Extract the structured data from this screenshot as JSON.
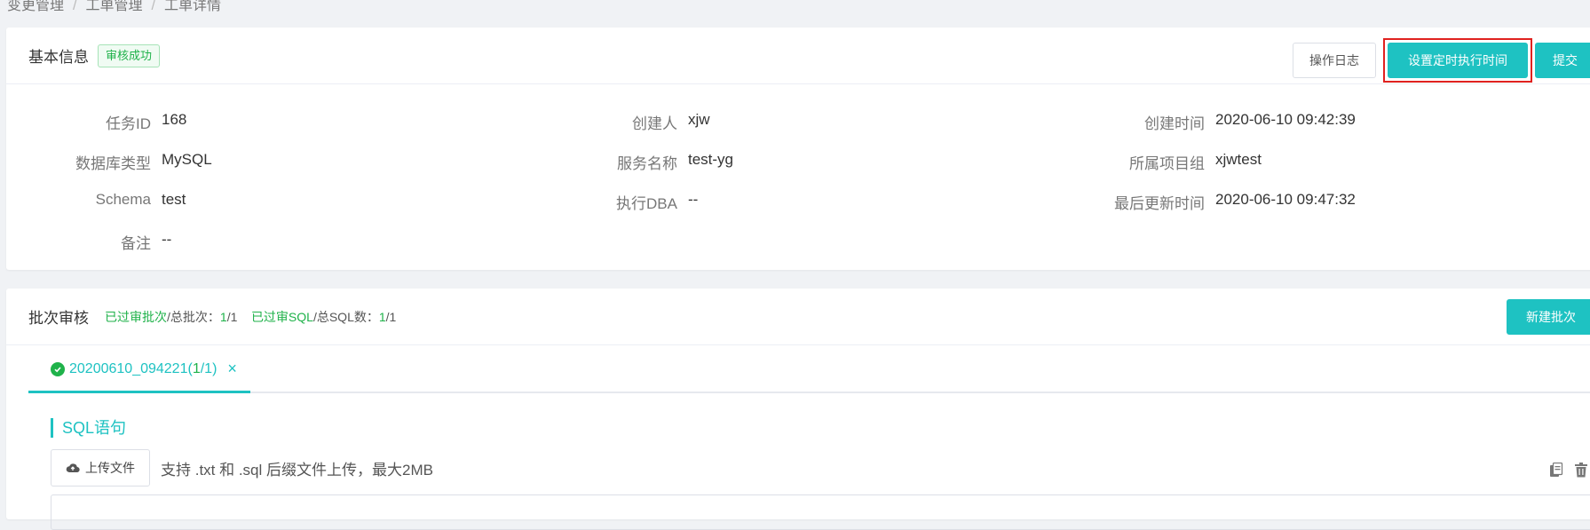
{
  "breadcrumb": {
    "items": [
      "变更管理",
      "工单管理",
      "工单详情"
    ],
    "separator": "/"
  },
  "basic": {
    "title": "基本信息",
    "status_tag": "审核成功",
    "btn_log": "操作日志",
    "btn_schedule": "设置定时执行时间",
    "btn_submit": "提交",
    "fields": {
      "task_id": {
        "label": "任务ID",
        "value": "168"
      },
      "creator": {
        "label": "创建人",
        "value": "xjw"
      },
      "created_at": {
        "label": "创建时间",
        "value": "2020-06-10 09:42:39"
      },
      "db_type": {
        "label": "数据库类型",
        "value": "MySQL"
      },
      "service": {
        "label": "服务名称",
        "value": "test-yg"
      },
      "project": {
        "label": "所属项目组",
        "value": "xjwtest"
      },
      "schema": {
        "label": "Schema",
        "value": "test"
      },
      "dba": {
        "label": "执行DBA",
        "value": "--"
      },
      "updated_at": {
        "label": "最后更新时间",
        "value": "2020-06-10 09:47:32"
      },
      "remark": {
        "label": "备注",
        "value": "--"
      }
    }
  },
  "batch": {
    "title": "批次审核",
    "stat1_label": "已过审批次",
    "stat1_sep": "/总批次：",
    "stat1_passed": "1",
    "stat1_total": "/1",
    "stat2_label": "已过审SQL",
    "stat2_sep": "/总SQL数：",
    "stat2_passed": "1",
    "stat2_total": "/1",
    "btn_new": "新建批次",
    "tab": {
      "prefix": "20200610_094221(",
      "passed": "1",
      "suffix": "/1)",
      "close": "×"
    },
    "sql_heading": "SQL语句",
    "upload_btn": "上传文件",
    "upload_hint": "支持 .txt 和 .sql 后缀文件上传，最大2MB"
  },
  "colors": {
    "accent": "#1ec2c2",
    "success": "#1fb24a",
    "highlight": "#e0221f"
  },
  "icons": [
    "check-circle-icon",
    "close-icon",
    "cloud-upload-icon",
    "copy-icon",
    "trash-icon"
  ]
}
